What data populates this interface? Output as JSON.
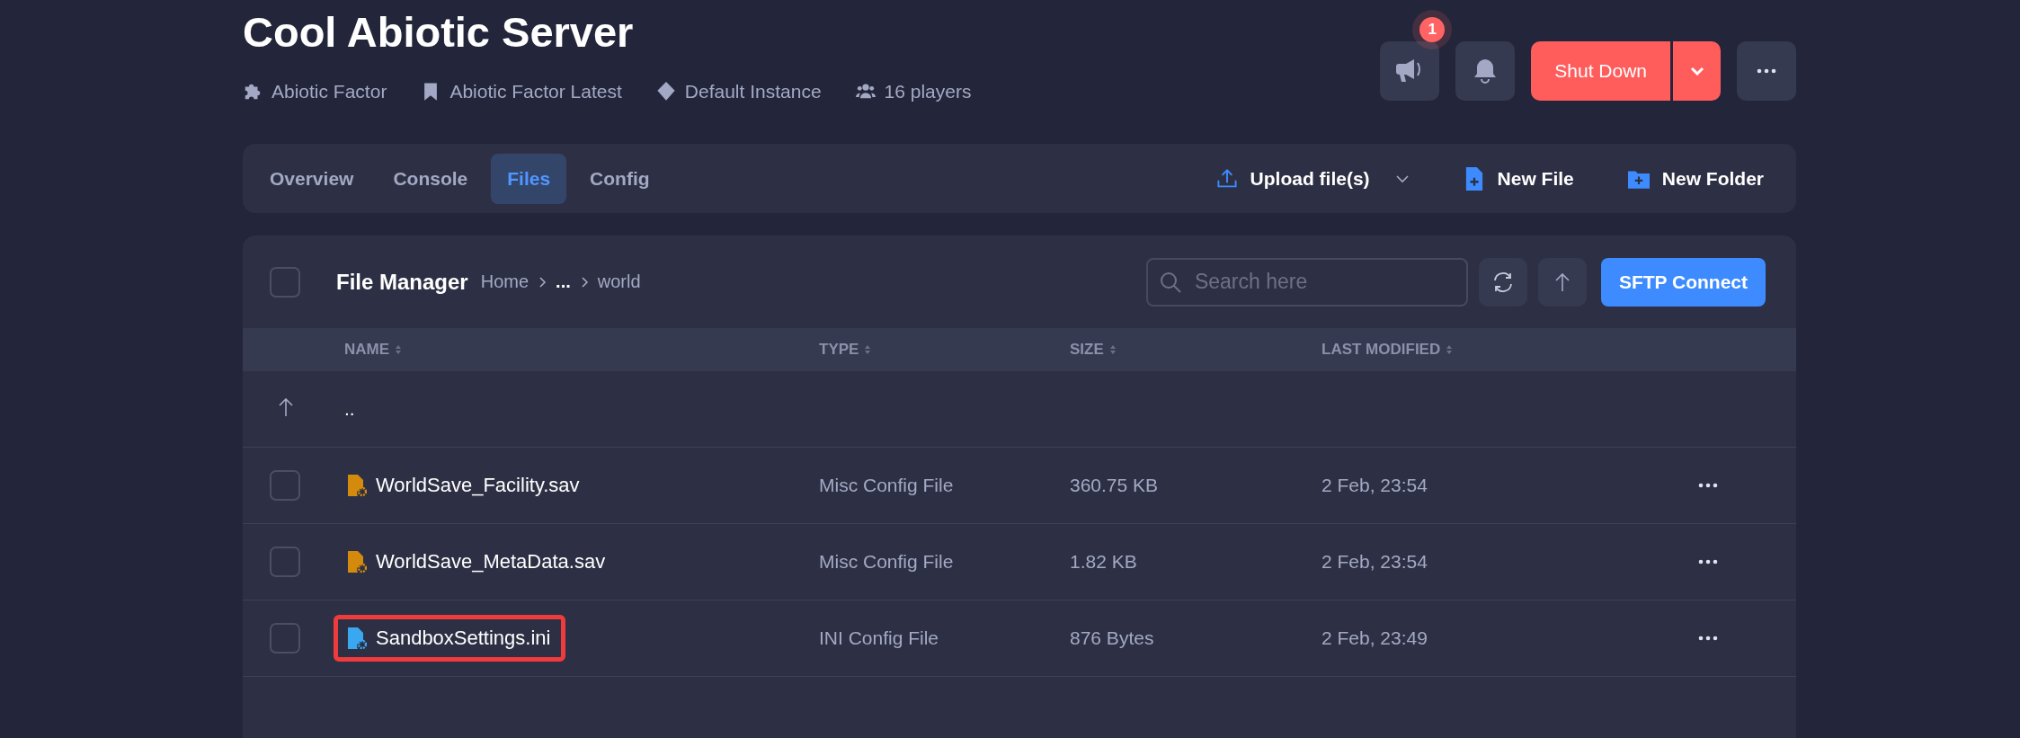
{
  "server": {
    "title": "Cool Abiotic Server",
    "meta": [
      {
        "kind": "game",
        "text": "Abiotic Factor"
      },
      {
        "kind": "version",
        "text": "Abiotic Factor Latest"
      },
      {
        "kind": "instance",
        "text": "Default Instance"
      },
      {
        "kind": "players",
        "text": "16 players"
      }
    ]
  },
  "actions": {
    "announce_badge": "1",
    "power_button": "Shut Down"
  },
  "tabs": [
    {
      "label": "Overview",
      "selected": false
    },
    {
      "label": "Console",
      "selected": false
    },
    {
      "label": "Files",
      "selected": true
    },
    {
      "label": "Config",
      "selected": false
    }
  ],
  "toolbar": [
    {
      "kind": "upload",
      "label": "Upload file(s)"
    },
    {
      "kind": "new-file",
      "label": "New File"
    },
    {
      "kind": "new-folder",
      "label": "New Folder"
    }
  ],
  "file_manager": {
    "title": "File Manager",
    "checked": false,
    "breadcrumb": [
      "Home",
      "...",
      "world"
    ],
    "search": {
      "placeholder": "Search here"
    },
    "sftp_button": "SFTP Connect",
    "columns": [
      "NAME",
      "TYPE",
      "SIZE",
      "LAST MODIFIED"
    ],
    "parent_row": "..",
    "rows": [
      {
        "name": "WorldSave_Facility.sav",
        "type": "Misc Config File",
        "size": "360.75 KB",
        "modified": "2 Feb, 23:54",
        "checked": false,
        "highlighted": false,
        "color": "#d48a0c"
      },
      {
        "name": "WorldSave_MetaData.sav",
        "type": "Misc Config File",
        "size": "1.82 KB",
        "modified": "2 Feb, 23:54",
        "checked": false,
        "highlighted": false,
        "color": "#d48a0c"
      },
      {
        "name": "SandboxSettings.ini",
        "type": "INI Config File",
        "size": "876 Bytes",
        "modified": "2 Feb, 23:49",
        "checked": false,
        "highlighted": true,
        "color": "#3aa8f0"
      }
    ]
  }
}
